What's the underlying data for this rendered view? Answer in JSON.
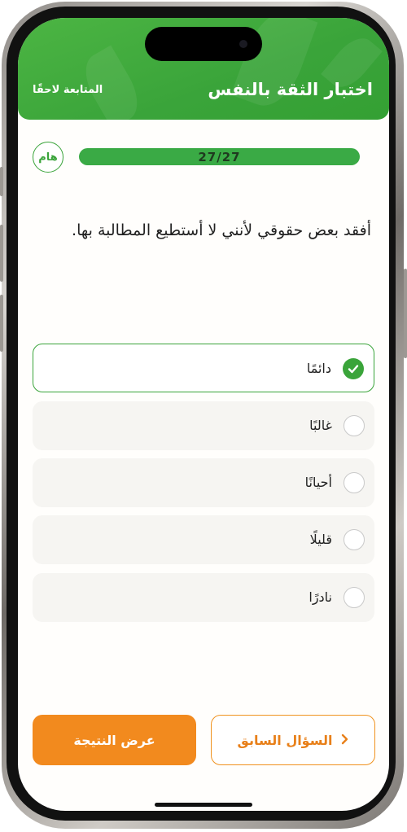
{
  "header": {
    "title": "اختبار الثقة بالنفس",
    "later_label": "المتابعة لاحقًا",
    "color": "#3aa43a"
  },
  "badge": {
    "label": "هام"
  },
  "progress": {
    "text": "27/27",
    "fraction": 1.0
  },
  "question": {
    "text": "أفقد بعض حقوقي لأنني لا أستطيع المطالبة بها."
  },
  "options": [
    {
      "label": "دائمًا",
      "selected": true
    },
    {
      "label": "غالبًا",
      "selected": false
    },
    {
      "label": "أحيانًا",
      "selected": false
    },
    {
      "label": "قليلًا",
      "selected": false
    },
    {
      "label": "نادرًا",
      "selected": false
    }
  ],
  "footer": {
    "prev_label": "السؤال السابق",
    "result_label": "عرض النتيجة",
    "accent": "#f28a1e"
  },
  "icons": [
    "check-icon",
    "chevron-left-icon"
  ]
}
